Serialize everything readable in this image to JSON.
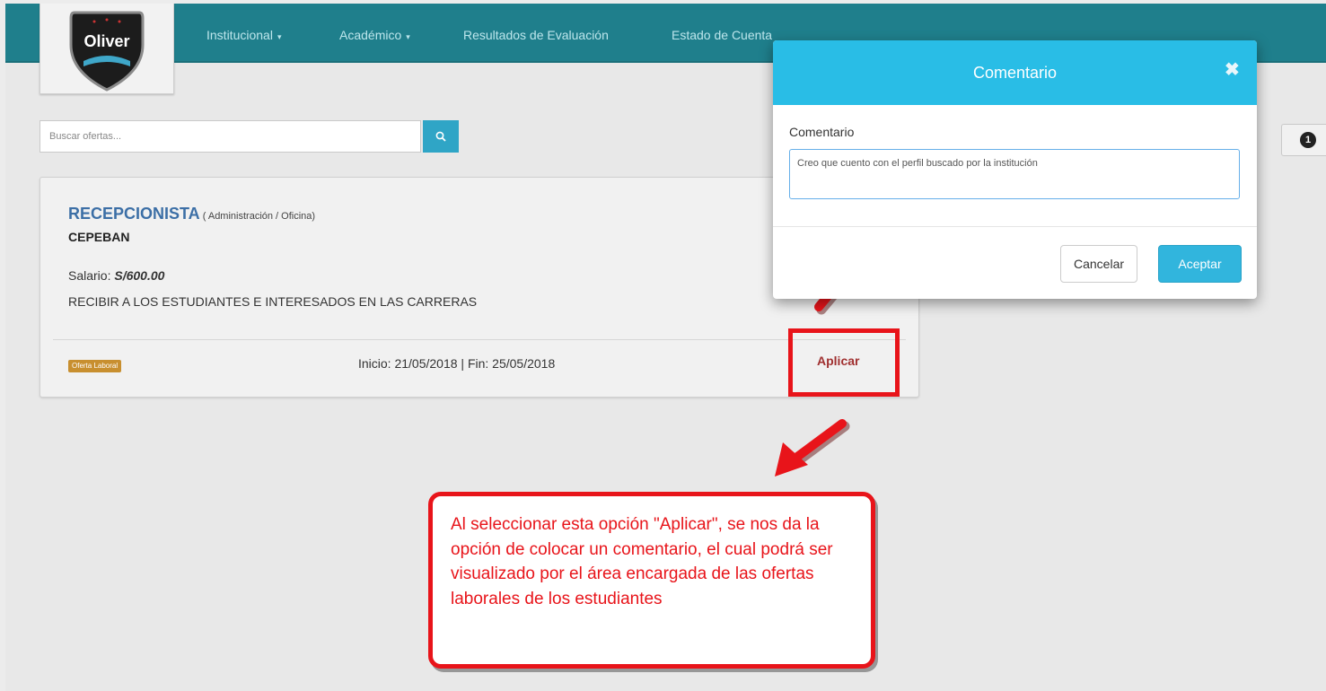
{
  "nav": {
    "items": [
      "Institucional",
      "Académico",
      "Resultados de Evaluación",
      "Estado de Cuenta"
    ],
    "caret": "▾"
  },
  "logo": {
    "text": "Oliver"
  },
  "search": {
    "placeholder": "Buscar ofertas...",
    "icon": "search-icon"
  },
  "pagination": {
    "badge": "1"
  },
  "job": {
    "title": "RECEPCIONISTA",
    "category": " ( Administración / Oficina)",
    "company": "CEPEBAN",
    "salary_label": "Salario: ",
    "salary_value": "S/600.00",
    "description": "RECIBIR A LOS ESTUDIANTES E INTERESADOS EN LAS CARRERAS",
    "badge": "Oferta Laboral",
    "dates": "Inicio: 21/05/2018 | Fin: 25/05/2018",
    "apply_label": "Aplicar"
  },
  "modal": {
    "title": "Comentario",
    "close": "✖",
    "field_label": "Comentario",
    "field_value": "Creo que cuento con el perfil buscado por la institución",
    "cancel_label": "Cancelar",
    "accept_label": "Aceptar"
  },
  "callout": {
    "text": "Al seleccionar esta opción \"Aplicar\", se nos da la opción de colocar un comentario, el cual podrá ser visualizado por el área encargada de las ofertas laborales de los estudiantes"
  },
  "colors": {
    "navbar": "#1f7f8c",
    "modal_header": "#29bde6",
    "accept_button": "#31b5dd",
    "annotation": "#e8141a",
    "badge": "#c88f2f"
  }
}
